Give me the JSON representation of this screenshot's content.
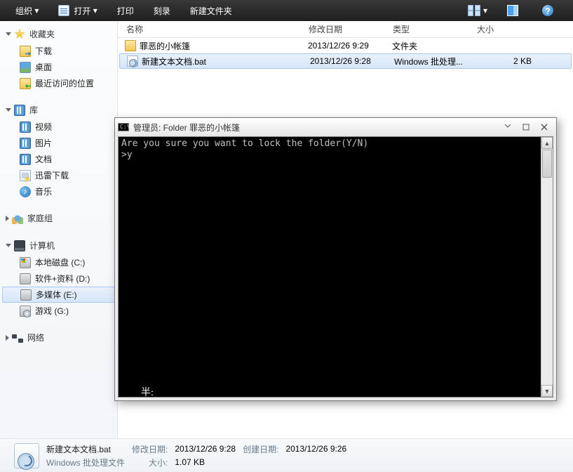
{
  "toolbar": {
    "organize": "组织",
    "open": "打开",
    "print": "打印",
    "burn": "刻录",
    "newfolder": "新建文件夹"
  },
  "sidebar": {
    "favorites": {
      "label": "收藏夹",
      "items": [
        {
          "label": "下载"
        },
        {
          "label": "桌面"
        },
        {
          "label": "最近访问的位置"
        }
      ]
    },
    "libraries": {
      "label": "库",
      "items": [
        {
          "label": "视频"
        },
        {
          "label": "图片"
        },
        {
          "label": "文档"
        },
        {
          "label": "迅雷下载"
        },
        {
          "label": "音乐"
        }
      ]
    },
    "homegroup": {
      "label": "家庭组"
    },
    "computer": {
      "label": "计算机",
      "items": [
        {
          "label": "本地磁盘 (C:)"
        },
        {
          "label": "软件+资料 (D:)"
        },
        {
          "label": "多媒体 (E:)"
        },
        {
          "label": "游戏 (G:)"
        }
      ]
    },
    "network": {
      "label": "网络"
    }
  },
  "columns": {
    "name": "名称",
    "modified": "修改日期",
    "type": "类型",
    "size": "大小"
  },
  "columnWidths": {
    "name": 260,
    "modified": 120,
    "type": 120,
    "size": 80
  },
  "files": [
    {
      "name": "罪恶的小帐篷",
      "modified": "2013/12/26 9:29",
      "type": "文件夹",
      "size": ""
    },
    {
      "name": "新建文本文档.bat",
      "modified": "2013/12/26 9:28",
      "type": "Windows 批处理...",
      "size": "2 KB"
    }
  ],
  "console": {
    "title": "管理员: Folder 罪恶的小帐篷",
    "lines": [
      "Are you sure you want to lock the folder(Y/N)",
      ">y",
      ""
    ],
    "ime": "半:"
  },
  "details": {
    "filename": "新建文本文档.bat",
    "filetype": "Windows 批处理文件",
    "modLabel": "修改日期:",
    "modValue": "2013/12/26 9:28",
    "sizeLabel": "大小:",
    "sizeValue": "1.07 KB",
    "createdLabel": "创建日期:",
    "createdValue": "2013/12/26 9:26"
  }
}
